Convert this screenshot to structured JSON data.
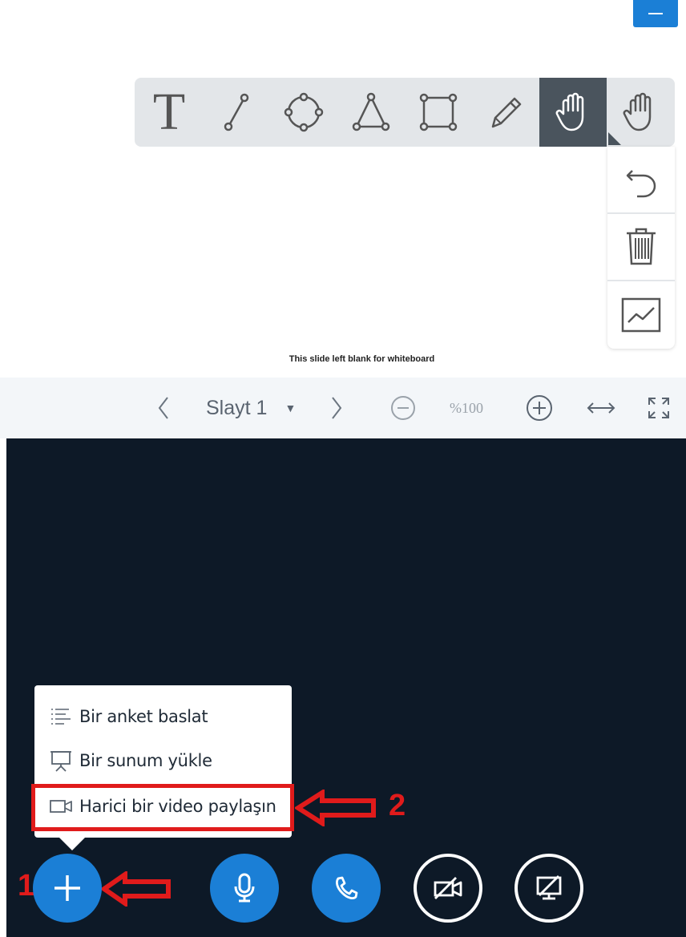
{
  "top_button": {
    "icon": "minimize-icon",
    "color": "#1b7fd6"
  },
  "whiteboard": {
    "tools": [
      {
        "name": "text",
        "icon": "text-tool-icon",
        "glyph": "T"
      },
      {
        "name": "line",
        "icon": "line-tool-icon"
      },
      {
        "name": "ellipse",
        "icon": "ellipse-tool-icon"
      },
      {
        "name": "triangle",
        "icon": "triangle-tool-icon"
      },
      {
        "name": "rectangle",
        "icon": "rectangle-tool-icon"
      },
      {
        "name": "pencil",
        "icon": "pencil-tool-icon"
      },
      {
        "name": "hand",
        "icon": "hand-tool-icon",
        "active": true
      },
      {
        "name": "hand-menu",
        "icon": "hand-icon"
      }
    ],
    "side_tools": [
      {
        "name": "undo",
        "icon": "undo-icon"
      },
      {
        "name": "clear",
        "icon": "trash-icon"
      },
      {
        "name": "multi-user",
        "icon": "chart-icon"
      }
    ],
    "blank_text": "This slide left blank for whiteboard"
  },
  "navbar": {
    "prev": "‹",
    "slide_label": "Slayt 1",
    "dropdown": "▼",
    "next": "›",
    "zoom_out_icon": "zoom-out-icon",
    "zoom_level": "%100",
    "zoom_in_icon": "zoom-in-icon",
    "fit_width_icon": "fit-width-icon",
    "fullscreen_icon": "fullscreen-icon"
  },
  "actions_menu": {
    "items": [
      {
        "label": "Bir anket baslat",
        "icon": "poll-icon"
      },
      {
        "label": "Bir sunum yükle",
        "icon": "presentation-icon"
      },
      {
        "label": "Harici bir video paylaşın",
        "icon": "video-icon"
      }
    ]
  },
  "bottom_bar": {
    "buttons": [
      {
        "name": "actions",
        "icon": "plus-icon"
      },
      {
        "name": "microphone",
        "icon": "microphone-icon"
      },
      {
        "name": "audio",
        "icon": "phone-icon"
      },
      {
        "name": "webcam",
        "icon": "video-off-icon"
      },
      {
        "name": "screenshare",
        "icon": "screen-share-off-icon"
      }
    ]
  },
  "annotations": {
    "label_1": "1",
    "label_2": "2",
    "color": "#e01b1b"
  },
  "colors": {
    "accent": "#1b7fd6",
    "dark_bg": "#0d1927",
    "toolbar_bg": "#e3e6e9",
    "active_tool": "#4a545d"
  }
}
